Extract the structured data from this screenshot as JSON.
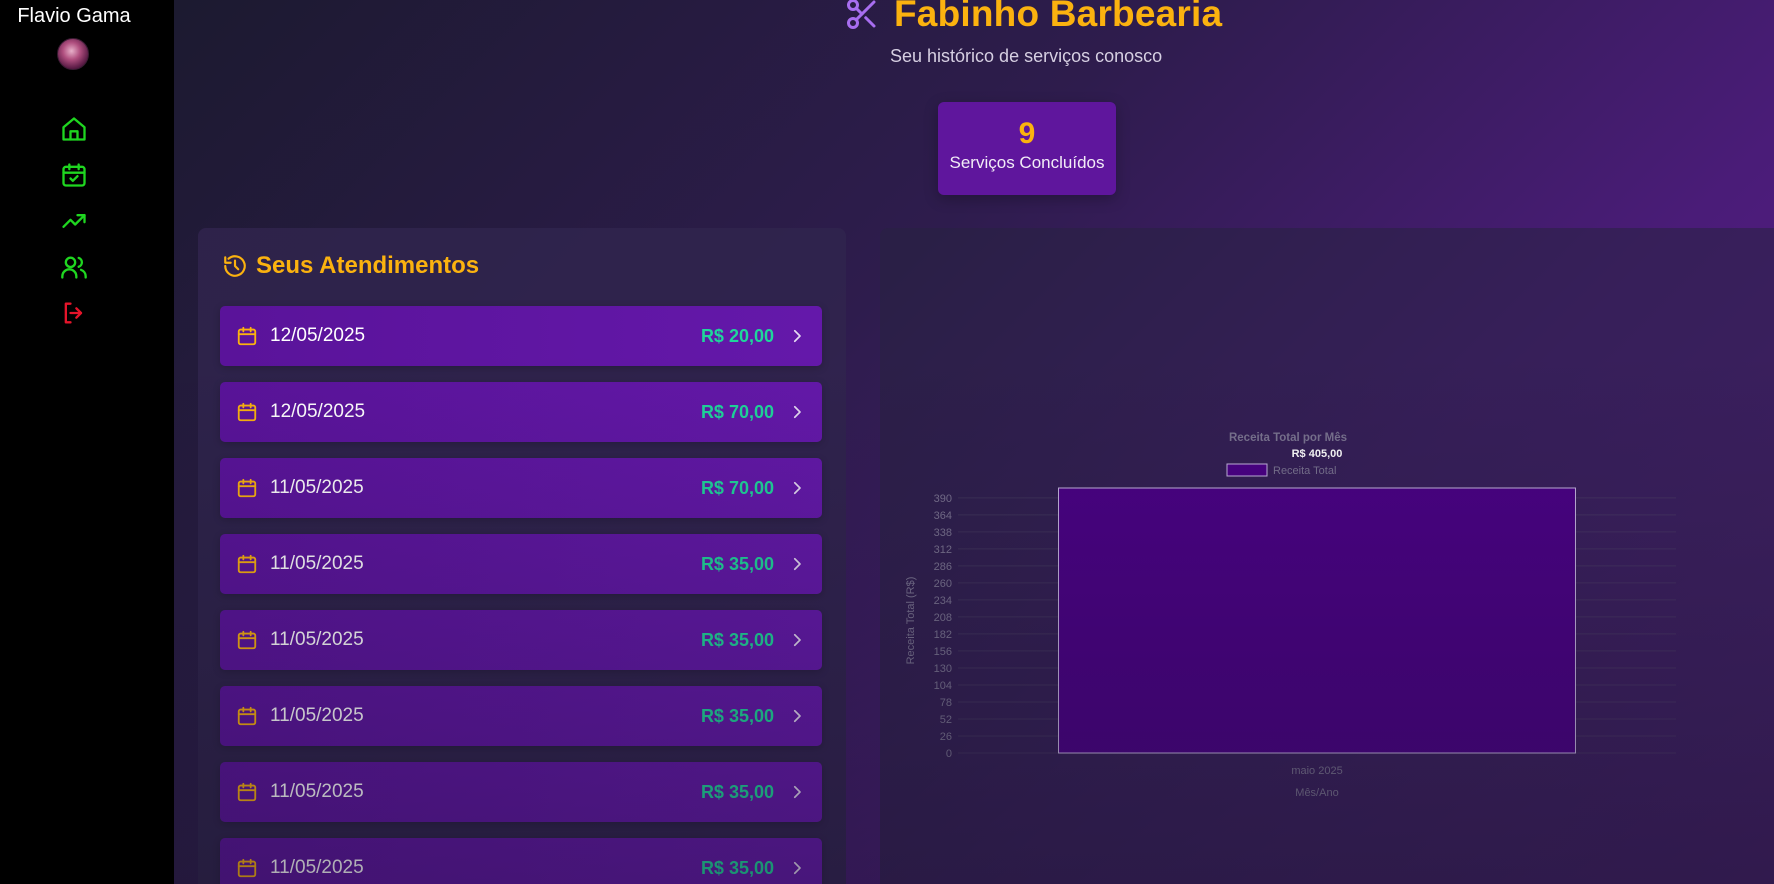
{
  "sidebar": {
    "user_name": "Flavio Gama",
    "nav": [
      {
        "icon": "home-icon",
        "color": "#1fd620"
      },
      {
        "icon": "calendar-check-icon",
        "color": "#1fd620"
      },
      {
        "icon": "trending-up-icon",
        "color": "#1fd620"
      },
      {
        "icon": "users-icon",
        "color": "#1fd620"
      },
      {
        "icon": "logout-icon",
        "color": "#e5142a"
      }
    ]
  },
  "header": {
    "title": "Fabinho Barbearia",
    "subtitle": "Seu histórico de serviços conosco"
  },
  "stats": {
    "value": "9",
    "label": "Serviços Concluídos"
  },
  "history": {
    "title": "Seus Atendimentos",
    "items": [
      {
        "date": "12/05/2025",
        "price": "R$ 20,00"
      },
      {
        "date": "12/05/2025",
        "price": "R$ 70,00"
      },
      {
        "date": "11/05/2025",
        "price": "R$ 70,00"
      },
      {
        "date": "11/05/2025",
        "price": "R$ 35,00"
      },
      {
        "date": "11/05/2025",
        "price": "R$ 35,00"
      },
      {
        "date": "11/05/2025",
        "price": "R$ 35,00"
      },
      {
        "date": "11/05/2025",
        "price": "R$ 35,00"
      },
      {
        "date": "11/05/2025",
        "price": "R$ 35,00"
      }
    ]
  },
  "colors": {
    "accent": "#fbb20f",
    "price": "#1fd69b",
    "card": "#5f169d",
    "bar": "#4a0185"
  },
  "chart_data": {
    "type": "bar",
    "title": "Receita Total por Mês",
    "categories": [
      "maio 2025"
    ],
    "series": [
      {
        "name": "Receita Total",
        "values": [
          405
        ]
      }
    ],
    "data_labels": [
      "R$ 405,00"
    ],
    "xlabel": "Mês/Ano",
    "ylabel": "Receita Total (R$)",
    "ylim": [
      0,
      405
    ],
    "yticks": [
      0,
      26,
      52,
      78,
      104,
      130,
      156,
      182,
      208,
      234,
      260,
      286,
      312,
      338,
      364,
      390
    ],
    "grid": true,
    "legend": "top"
  }
}
